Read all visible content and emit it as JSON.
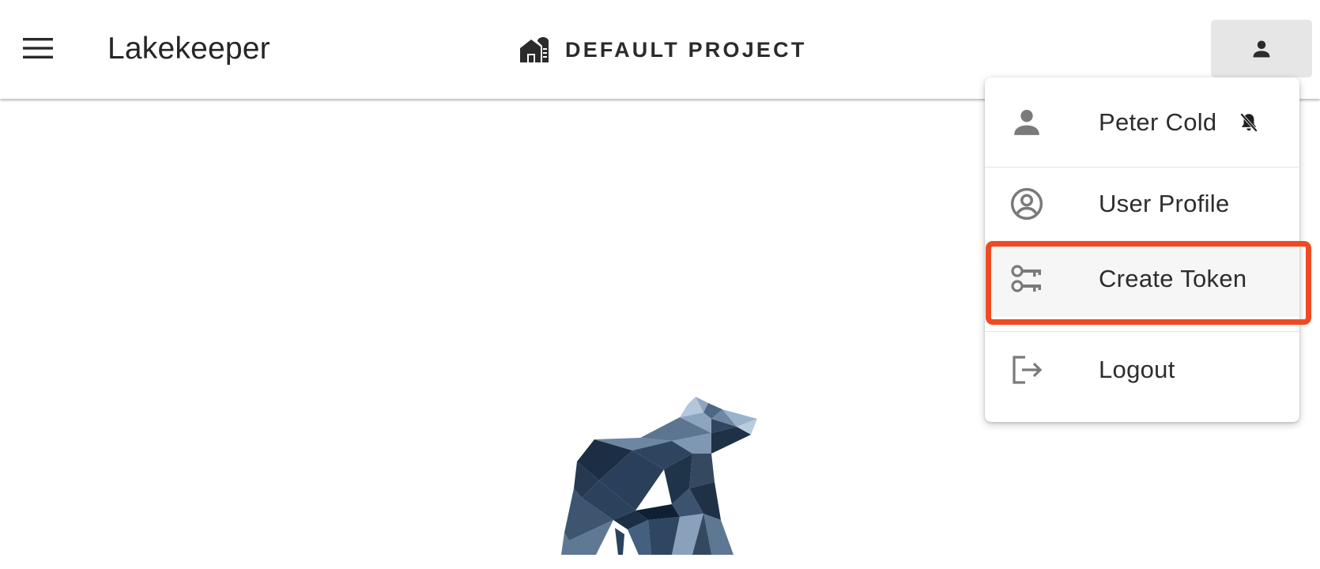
{
  "app": {
    "title": "Lakekeeper"
  },
  "header": {
    "menu_icon": "hamburger-menu-icon",
    "project_icon": "warehouse-icon",
    "project_label": "DEFAULT PROJECT",
    "user_icon": "person-icon"
  },
  "user_menu": {
    "user": {
      "icon": "person-icon",
      "label": "Peter Cold",
      "badge_icon": "notifications-off-icon"
    },
    "profile": {
      "icon": "account-circle-icon",
      "label": "User Profile"
    },
    "token": {
      "icon": "key-icon",
      "label": "Create Token"
    },
    "logout": {
      "icon": "logout-icon",
      "label": "Logout"
    }
  },
  "colors": {
    "highlight": "#f04a23",
    "icon_gray": "#7a7a7a",
    "bear_dark": "#1f3246",
    "bear_light": "#b9cde2"
  }
}
